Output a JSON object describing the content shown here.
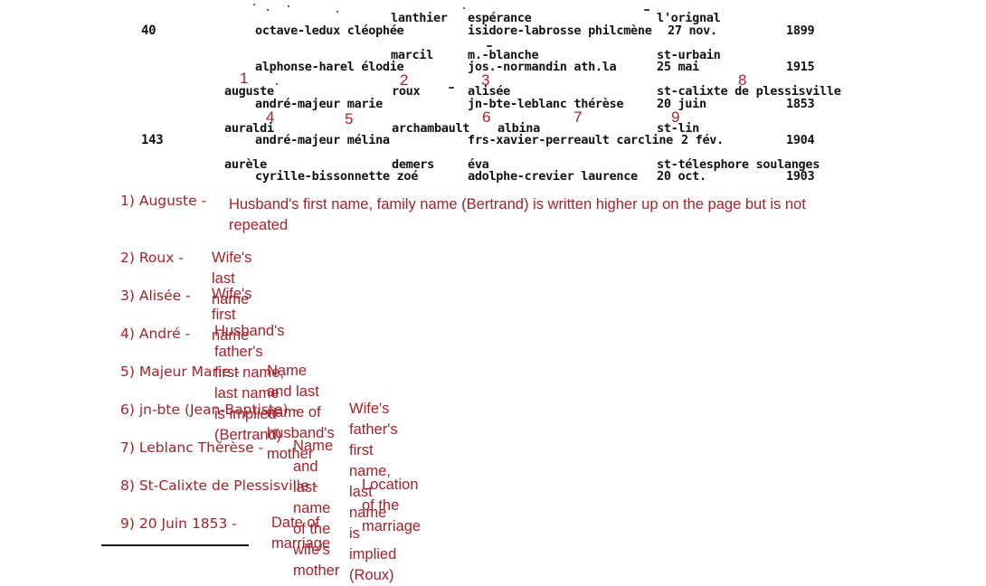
{
  "scan": {
    "entries": [
      {
        "left_number": "40",
        "line1": {
          "husband": "",
          "wife_last": "lanthier",
          "wife_first": "espérance",
          "place": "l'orignal"
        },
        "line2": {
          "husband_parents": "octave-ledux cléophée",
          "wife_parents": "isidore-labrosse philcmène",
          "day": "27 nov.",
          "year": "1899"
        }
      },
      {
        "left_number": "",
        "line1": {
          "husband": "",
          "wife_last": "marcil",
          "wife_first": "m.-blanche",
          "place": "st-urbain"
        },
        "line2": {
          "husband_parents": "alphonse-harel élodie",
          "wife_parents": "jos.-normandin ath.la",
          "day": "25 mai",
          "year": "1915"
        }
      },
      {
        "left_number": "",
        "line1": {
          "husband": "auguste",
          "wife_last": "roux",
          "wife_first": "alisée",
          "place": "st-calixte de plessisville"
        },
        "line2": {
          "husband_parents": "andré-majeur marie",
          "wife_parents": "jn-bte-leblanc thérèse",
          "day": "20 juin",
          "year": "1853"
        }
      },
      {
        "left_number": "143",
        "line1": {
          "husband": "auraldi",
          "wife_last": "archambault",
          "wife_first": "albina",
          "place": "st-lin"
        },
        "line2": {
          "husband_parents": "andré-majeur mélina",
          "wife_parents": "frs-xavier-perreault carcline",
          "day": "2 fév.",
          "year": "1904"
        }
      },
      {
        "left_number": "",
        "line1": {
          "husband": "aurèle",
          "wife_last": "demers",
          "wife_first": "éva",
          "place": "st-télesphore soulanges"
        },
        "line2": {
          "husband_parents": "cyrille-bissonnette zoé",
          "wife_parents": "adolphe-crevier laurence",
          "day": "20 oct.",
          "year": "1903"
        }
      }
    ],
    "markers": [
      "1",
      "2",
      "3",
      "4",
      "5",
      "6",
      "7",
      "8",
      "9"
    ]
  },
  "legend": [
    {
      "key": "1) Auguste -",
      "desc": "Husband's first name, family name (Bertrand) is written higher up on the page but is not repeated"
    },
    {
      "key": "2) Roux -",
      "desc": "Wife's last name"
    },
    {
      "key": "3) Alisée -",
      "desc": "Wife's first name"
    },
    {
      "key": "4) André -",
      "desc": "Husband's father's first name, last name is implied (Bertrand)"
    },
    {
      "key": "5) Majeur Marie -",
      "desc": "Name and last name of husband's mother"
    },
    {
      "key": "6) jn-bte (Jean-Baptiste) -",
      "desc": "Wife's father's first name, last name is implied (Roux)"
    },
    {
      "key": "7) Leblanc Thérèse -",
      "desc": "Name and last name of the wife's mother"
    },
    {
      "key": "8) St-Calixte de Plessisville -",
      "desc": "Location of the marriage"
    },
    {
      "key": "9) 20 Juin 1853 -",
      "desc": "Date of marriage"
    }
  ],
  "colors": {
    "annotation_red": "#a8202a",
    "typewriter_ink": "#111111"
  }
}
